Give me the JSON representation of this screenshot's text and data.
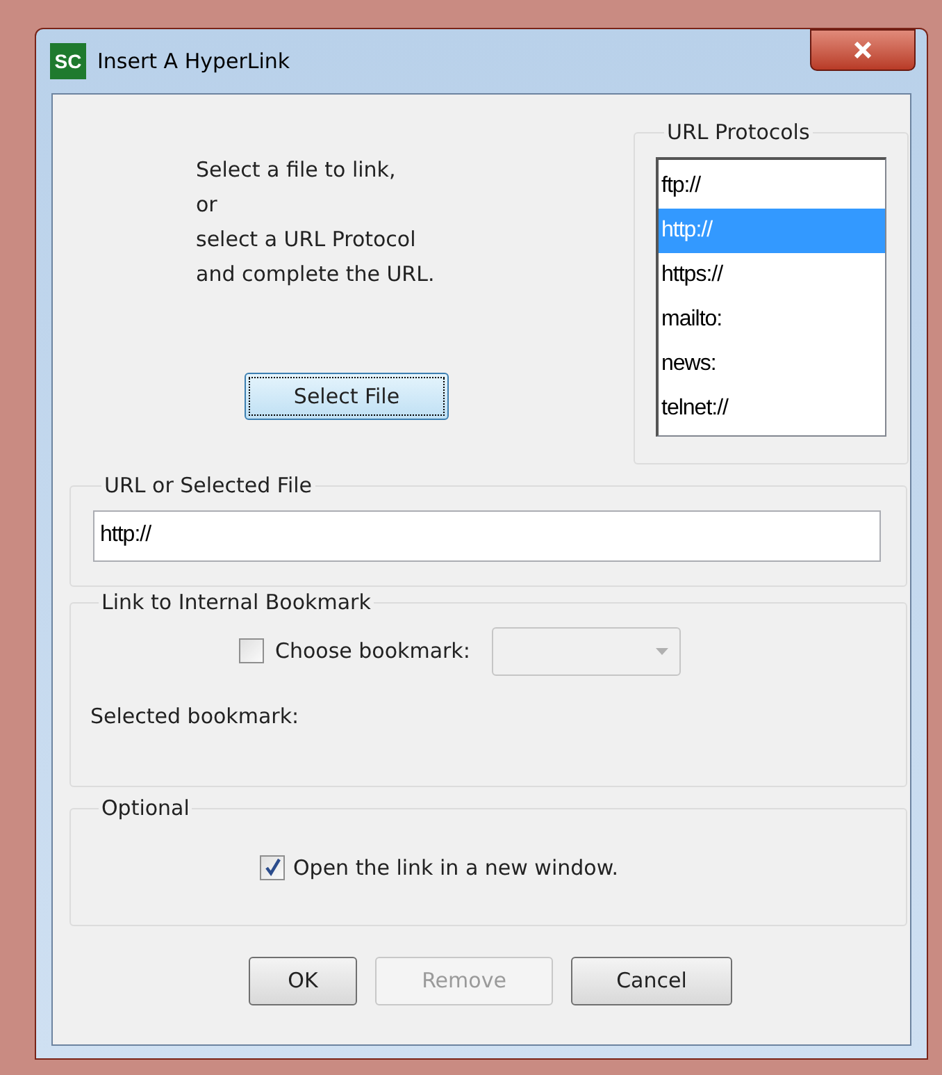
{
  "window": {
    "title": "Insert A HyperLink",
    "app_icon": "SC"
  },
  "instructions": [
    "Select a file to link,",
    "or",
    "select a URL Protocol",
    "and complete the URL."
  ],
  "select_file_button": {
    "label": "Select File"
  },
  "url_protocols": {
    "title": "URL Protocols",
    "items": [
      {
        "label": "ftp://",
        "selected": false
      },
      {
        "label": "http://",
        "selected": true
      },
      {
        "label": "https://",
        "selected": false
      },
      {
        "label": "mailto:",
        "selected": false
      },
      {
        "label": "news:",
        "selected": false
      },
      {
        "label": "telnet://",
        "selected": false
      }
    ]
  },
  "url_group": {
    "title": "URL or Selected File",
    "value": "http://"
  },
  "bookmark_group": {
    "title": "Link to Internal Bookmark",
    "checkbox": {
      "label": "Choose bookmark:",
      "checked": false
    },
    "dropdown": {
      "disabled": true
    },
    "selected_label": "Selected bookmark:"
  },
  "optional_group": {
    "title": "Optional",
    "checkbox": {
      "label": "Open the link in a new window.",
      "checked": true
    }
  },
  "buttons": [
    {
      "label": "OK",
      "disabled": false
    },
    {
      "label": "Remove",
      "disabled": true
    },
    {
      "label": "Cancel",
      "disabled": false
    }
  ]
}
